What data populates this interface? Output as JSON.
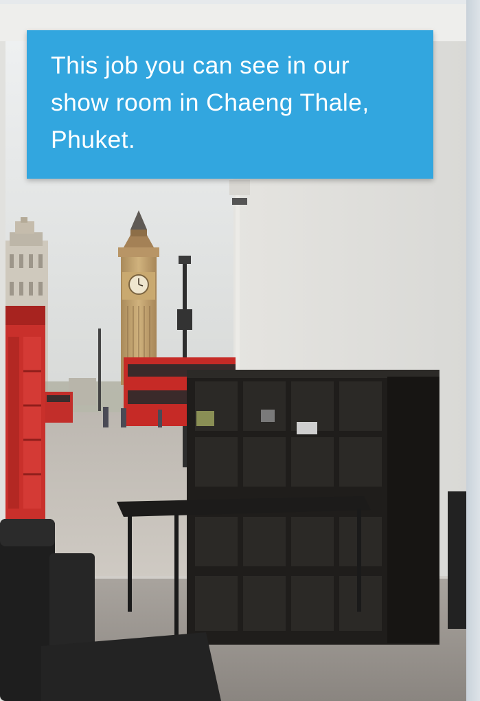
{
  "caption": {
    "lines": [
      "This job you can see in our",
      "show room in Chaeng Thale,",
      "Phuket."
    ],
    "background": "#32a6df",
    "text_color": "#ffffff"
  },
  "photo": {
    "scene_elements": [
      "wall-mural-london",
      "big-ben-tower",
      "red-telephone-box",
      "red-double-decker-bus",
      "street-lamp",
      "black-cube-shelf",
      "black-desk",
      "black-leather-armchair",
      "ceiling-camera"
    ]
  }
}
